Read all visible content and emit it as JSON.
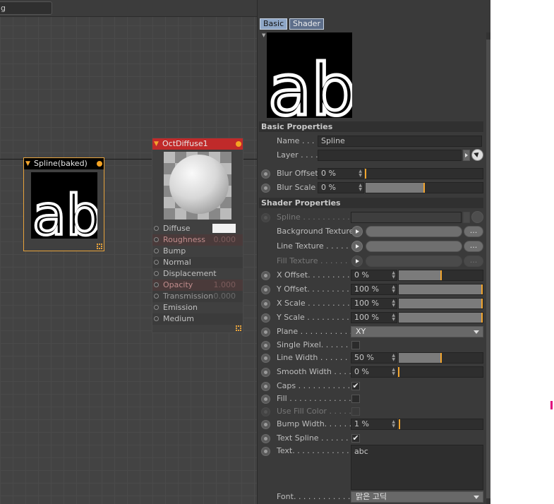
{
  "graph": {
    "search_text": "g",
    "spline_node": {
      "title": "Spline(baked)",
      "thumb_text": "ab"
    },
    "oct_node": {
      "title": "OctDiffuse1",
      "ports": [
        {
          "label": "Diffuse",
          "swatch": "#f2f2f2"
        },
        {
          "label": "Roughness",
          "value": "0.000"
        },
        {
          "label": "Bump"
        },
        {
          "label": "Normal"
        },
        {
          "label": "Displacement"
        },
        {
          "label": "Opacity",
          "value": "1.000"
        },
        {
          "label": "Transmission",
          "value": "0.000"
        },
        {
          "label": "Emission"
        },
        {
          "label": "Medium"
        }
      ]
    }
  },
  "panel": {
    "tabs": {
      "basic": "Basic",
      "shader": "Shader"
    },
    "preview_text": "ab",
    "basic_section": "Basic Properties",
    "name_label": "Name . . .",
    "name_value": "Spline",
    "layer_label": "Layer . . . .",
    "blur_offset": {
      "label": "Blur Offset",
      "value": "0 %",
      "fraction": 0.0
    },
    "blur_scale": {
      "label": "Blur Scale",
      "value": "0 %",
      "fraction": 0.5
    },
    "shader_section": "Shader Properties",
    "spline_label": "Spline . . . . . . . . . . .",
    "bg_texture_label": "Background Texture",
    "line_texture_label": "Line Texture . . . . . .",
    "fill_texture_label": "Fill Texture . . . . . .",
    "x_offset": {
      "label": "X Offset. . . . . . . . . .",
      "value": "0 %",
      "fraction": 0.5
    },
    "y_offset": {
      "label": "Y Offset. . . . . . . . . .",
      "value": "100 %",
      "fraction": 1.0
    },
    "x_scale": {
      "label": "X Scale . . . . . . . . . .",
      "value": "100 %",
      "fraction": 1.0
    },
    "y_scale": {
      "label": "Y Scale . . . . . . . . . .",
      "value": "100 %",
      "fraction": 1.0
    },
    "plane": {
      "label": "Plane . . . . . . . . . . . .",
      "value": "XY"
    },
    "single_pixel": {
      "label": "Single Pixel. . . . . . . .",
      "checked": false
    },
    "line_width": {
      "label": "Line Width . . . . . . .",
      "value": "50 %",
      "fraction": 0.5
    },
    "smooth_width": {
      "label": "Smooth Width . . . .",
      "value": "0 %",
      "fraction": 0.0
    },
    "caps": {
      "label": "Caps . . . . . . . . . . . .",
      "check": "✔"
    },
    "fill": {
      "label": "Fill . . . . . . . . . . . . . .",
      "checked": false
    },
    "use_fill_color": {
      "label": "Use Fill Color . . . . .",
      "checked": false
    },
    "bump_width": {
      "label": "Bump Width. . . . . . .",
      "value": "1 %",
      "fraction": 0.01
    },
    "text_spline": {
      "label": "Text Spline . . . . . . .",
      "check": "✔"
    },
    "text": {
      "label": "Text. . . . . . . . . . . . . .",
      "value": "abc"
    },
    "font": {
      "label": "Font. . . . . . . . . . . . .",
      "value": "맑은 고딕"
    },
    "more_button": "..."
  }
}
